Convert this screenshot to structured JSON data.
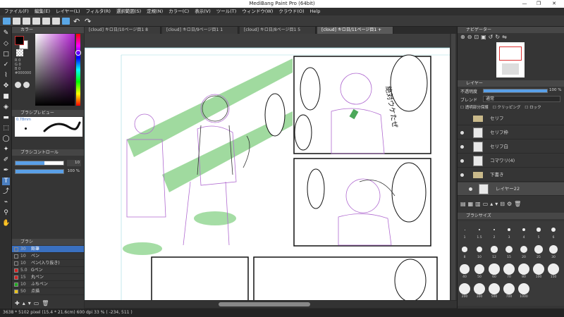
{
  "window": {
    "title": "MediBang Paint Pro (64bit)",
    "minimize": "—",
    "maximize": "❐",
    "close": "✕"
  },
  "menu": [
    "ファイル(F)",
    "編集(E)",
    "レイヤー(L)",
    "フィルタ(R)",
    "選択範囲(S)",
    "定規(N)",
    "カラー(C)",
    "表示(V)",
    "ツール(T)",
    "ウィンドウ(W)",
    "クラウド(O)",
    "Help"
  ],
  "tabs": [
    {
      "label": "[cloud] キロ日/10ページ目1 8",
      "active": false
    },
    {
      "label": "[cloud] キロ日/9ページ目1 1",
      "active": false
    },
    {
      "label": "[cloud] キロ日/8ページ目1 5",
      "active": false
    },
    {
      "label": "[cloud] キロ日/11ページ目1 +",
      "active": true
    }
  ],
  "left_panel": {
    "color_header": "カラー",
    "color_values": {
      "r": "R 0",
      "g": "G 0",
      "b": "B 0",
      "hex": "#000000"
    },
    "brush_preview_header": "ブラシプレビュー",
    "brush_preview_size": "0.78mm",
    "brush_control_header": "ブラシコントロール",
    "brush_size_value": "10",
    "brush_opacity_value": "100 %",
    "brush_size_fill": 0.6,
    "brush_opacity_fill": 1.0,
    "brush_header": "ブラシ",
    "brushes": [
      {
        "size": "30",
        "name": "鉛筆",
        "color": "#3a70c0",
        "selected": true
      },
      {
        "size": "10",
        "name": "ペン",
        "color": "#333333",
        "selected": false
      },
      {
        "size": "10",
        "name": "ペン(入り抜き)",
        "color": "#333333",
        "selected": false
      },
      {
        "size": "5.0",
        "name": "Gペン",
        "color": "#d22222",
        "selected": false
      },
      {
        "size": "15",
        "name": "丸ペン",
        "color": "#d22222",
        "selected": false
      },
      {
        "size": "10",
        "name": "ふちペン",
        "color": "#22aa22",
        "selected": false
      },
      {
        "size": "50",
        "name": "点描",
        "color": "#e8c21a",
        "selected": false
      }
    ]
  },
  "right_panel": {
    "navigator_header": "ナビゲーター",
    "layer_header": "レイヤー",
    "opacity_label": "不透明度",
    "opacity_value": "100 %",
    "opacity_fill": 1.0,
    "blend_label": "ブレンド",
    "blend_value": "通常",
    "checkbox_protect": "透明部分保護",
    "checkbox_clipping": "クリッピング",
    "checkbox_lock": "ロック",
    "layers": [
      {
        "name": "セリフ",
        "type": "folder",
        "visible": false,
        "indent": false,
        "selected": false
      },
      {
        "name": "セリフ枠",
        "type": "layer",
        "visible": true,
        "indent": false,
        "selected": false
      },
      {
        "name": "セリフ白",
        "type": "layer",
        "visible": true,
        "indent": false,
        "selected": false
      },
      {
        "name": "コマワリ(4)",
        "type": "layer",
        "visible": true,
        "indent": false,
        "selected": false
      },
      {
        "name": "下書き",
        "type": "folder",
        "visible": true,
        "indent": false,
        "selected": false
      },
      {
        "name": "レイヤー22",
        "type": "layer",
        "visible": true,
        "indent": true,
        "selected": true
      }
    ],
    "brush_size_header": "ブラシサイズ",
    "brush_sizes": [
      "1",
      "1.5",
      "2",
      "3",
      "4",
      "5",
      "6",
      "8",
      "10",
      "12",
      "15",
      "20",
      "25",
      "30",
      "40",
      "50",
      "60",
      "70",
      "80",
      "100",
      "150",
      "200",
      "300",
      "500",
      "700",
      "1000"
    ]
  },
  "status": {
    "text": "3638 * 5102 pixel  (15.4 * 21.6cm)  600 dpi  33 %  ( -234, 511 )"
  }
}
